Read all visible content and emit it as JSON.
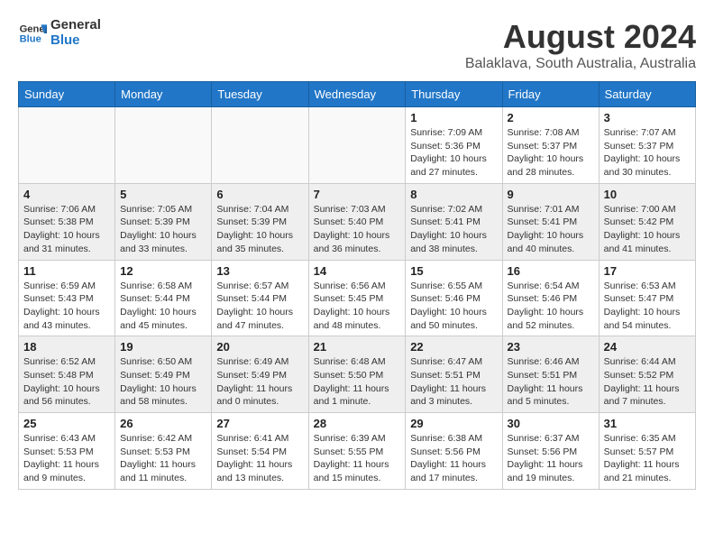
{
  "header": {
    "logo_line1": "General",
    "logo_line2": "Blue",
    "month_year": "August 2024",
    "location": "Balaklava, South Australia, Australia"
  },
  "weekdays": [
    "Sunday",
    "Monday",
    "Tuesday",
    "Wednesday",
    "Thursday",
    "Friday",
    "Saturday"
  ],
  "weeks": [
    [
      {
        "day": "",
        "info": ""
      },
      {
        "day": "",
        "info": ""
      },
      {
        "day": "",
        "info": ""
      },
      {
        "day": "",
        "info": ""
      },
      {
        "day": "1",
        "info": "Sunrise: 7:09 AM\nSunset: 5:36 PM\nDaylight: 10 hours\nand 27 minutes."
      },
      {
        "day": "2",
        "info": "Sunrise: 7:08 AM\nSunset: 5:37 PM\nDaylight: 10 hours\nand 28 minutes."
      },
      {
        "day": "3",
        "info": "Sunrise: 7:07 AM\nSunset: 5:37 PM\nDaylight: 10 hours\nand 30 minutes."
      }
    ],
    [
      {
        "day": "4",
        "info": "Sunrise: 7:06 AM\nSunset: 5:38 PM\nDaylight: 10 hours\nand 31 minutes."
      },
      {
        "day": "5",
        "info": "Sunrise: 7:05 AM\nSunset: 5:39 PM\nDaylight: 10 hours\nand 33 minutes."
      },
      {
        "day": "6",
        "info": "Sunrise: 7:04 AM\nSunset: 5:39 PM\nDaylight: 10 hours\nand 35 minutes."
      },
      {
        "day": "7",
        "info": "Sunrise: 7:03 AM\nSunset: 5:40 PM\nDaylight: 10 hours\nand 36 minutes."
      },
      {
        "day": "8",
        "info": "Sunrise: 7:02 AM\nSunset: 5:41 PM\nDaylight: 10 hours\nand 38 minutes."
      },
      {
        "day": "9",
        "info": "Sunrise: 7:01 AM\nSunset: 5:41 PM\nDaylight: 10 hours\nand 40 minutes."
      },
      {
        "day": "10",
        "info": "Sunrise: 7:00 AM\nSunset: 5:42 PM\nDaylight: 10 hours\nand 41 minutes."
      }
    ],
    [
      {
        "day": "11",
        "info": "Sunrise: 6:59 AM\nSunset: 5:43 PM\nDaylight: 10 hours\nand 43 minutes."
      },
      {
        "day": "12",
        "info": "Sunrise: 6:58 AM\nSunset: 5:44 PM\nDaylight: 10 hours\nand 45 minutes."
      },
      {
        "day": "13",
        "info": "Sunrise: 6:57 AM\nSunset: 5:44 PM\nDaylight: 10 hours\nand 47 minutes."
      },
      {
        "day": "14",
        "info": "Sunrise: 6:56 AM\nSunset: 5:45 PM\nDaylight: 10 hours\nand 48 minutes."
      },
      {
        "day": "15",
        "info": "Sunrise: 6:55 AM\nSunset: 5:46 PM\nDaylight: 10 hours\nand 50 minutes."
      },
      {
        "day": "16",
        "info": "Sunrise: 6:54 AM\nSunset: 5:46 PM\nDaylight: 10 hours\nand 52 minutes."
      },
      {
        "day": "17",
        "info": "Sunrise: 6:53 AM\nSunset: 5:47 PM\nDaylight: 10 hours\nand 54 minutes."
      }
    ],
    [
      {
        "day": "18",
        "info": "Sunrise: 6:52 AM\nSunset: 5:48 PM\nDaylight: 10 hours\nand 56 minutes."
      },
      {
        "day": "19",
        "info": "Sunrise: 6:50 AM\nSunset: 5:49 PM\nDaylight: 10 hours\nand 58 minutes."
      },
      {
        "day": "20",
        "info": "Sunrise: 6:49 AM\nSunset: 5:49 PM\nDaylight: 11 hours\nand 0 minutes."
      },
      {
        "day": "21",
        "info": "Sunrise: 6:48 AM\nSunset: 5:50 PM\nDaylight: 11 hours\nand 1 minute."
      },
      {
        "day": "22",
        "info": "Sunrise: 6:47 AM\nSunset: 5:51 PM\nDaylight: 11 hours\nand 3 minutes."
      },
      {
        "day": "23",
        "info": "Sunrise: 6:46 AM\nSunset: 5:51 PM\nDaylight: 11 hours\nand 5 minutes."
      },
      {
        "day": "24",
        "info": "Sunrise: 6:44 AM\nSunset: 5:52 PM\nDaylight: 11 hours\nand 7 minutes."
      }
    ],
    [
      {
        "day": "25",
        "info": "Sunrise: 6:43 AM\nSunset: 5:53 PM\nDaylight: 11 hours\nand 9 minutes."
      },
      {
        "day": "26",
        "info": "Sunrise: 6:42 AM\nSunset: 5:53 PM\nDaylight: 11 hours\nand 11 minutes."
      },
      {
        "day": "27",
        "info": "Sunrise: 6:41 AM\nSunset: 5:54 PM\nDaylight: 11 hours\nand 13 minutes."
      },
      {
        "day": "28",
        "info": "Sunrise: 6:39 AM\nSunset: 5:55 PM\nDaylight: 11 hours\nand 15 minutes."
      },
      {
        "day": "29",
        "info": "Sunrise: 6:38 AM\nSunset: 5:56 PM\nDaylight: 11 hours\nand 17 minutes."
      },
      {
        "day": "30",
        "info": "Sunrise: 6:37 AM\nSunset: 5:56 PM\nDaylight: 11 hours\nand 19 minutes."
      },
      {
        "day": "31",
        "info": "Sunrise: 6:35 AM\nSunset: 5:57 PM\nDaylight: 11 hours\nand 21 minutes."
      }
    ]
  ]
}
